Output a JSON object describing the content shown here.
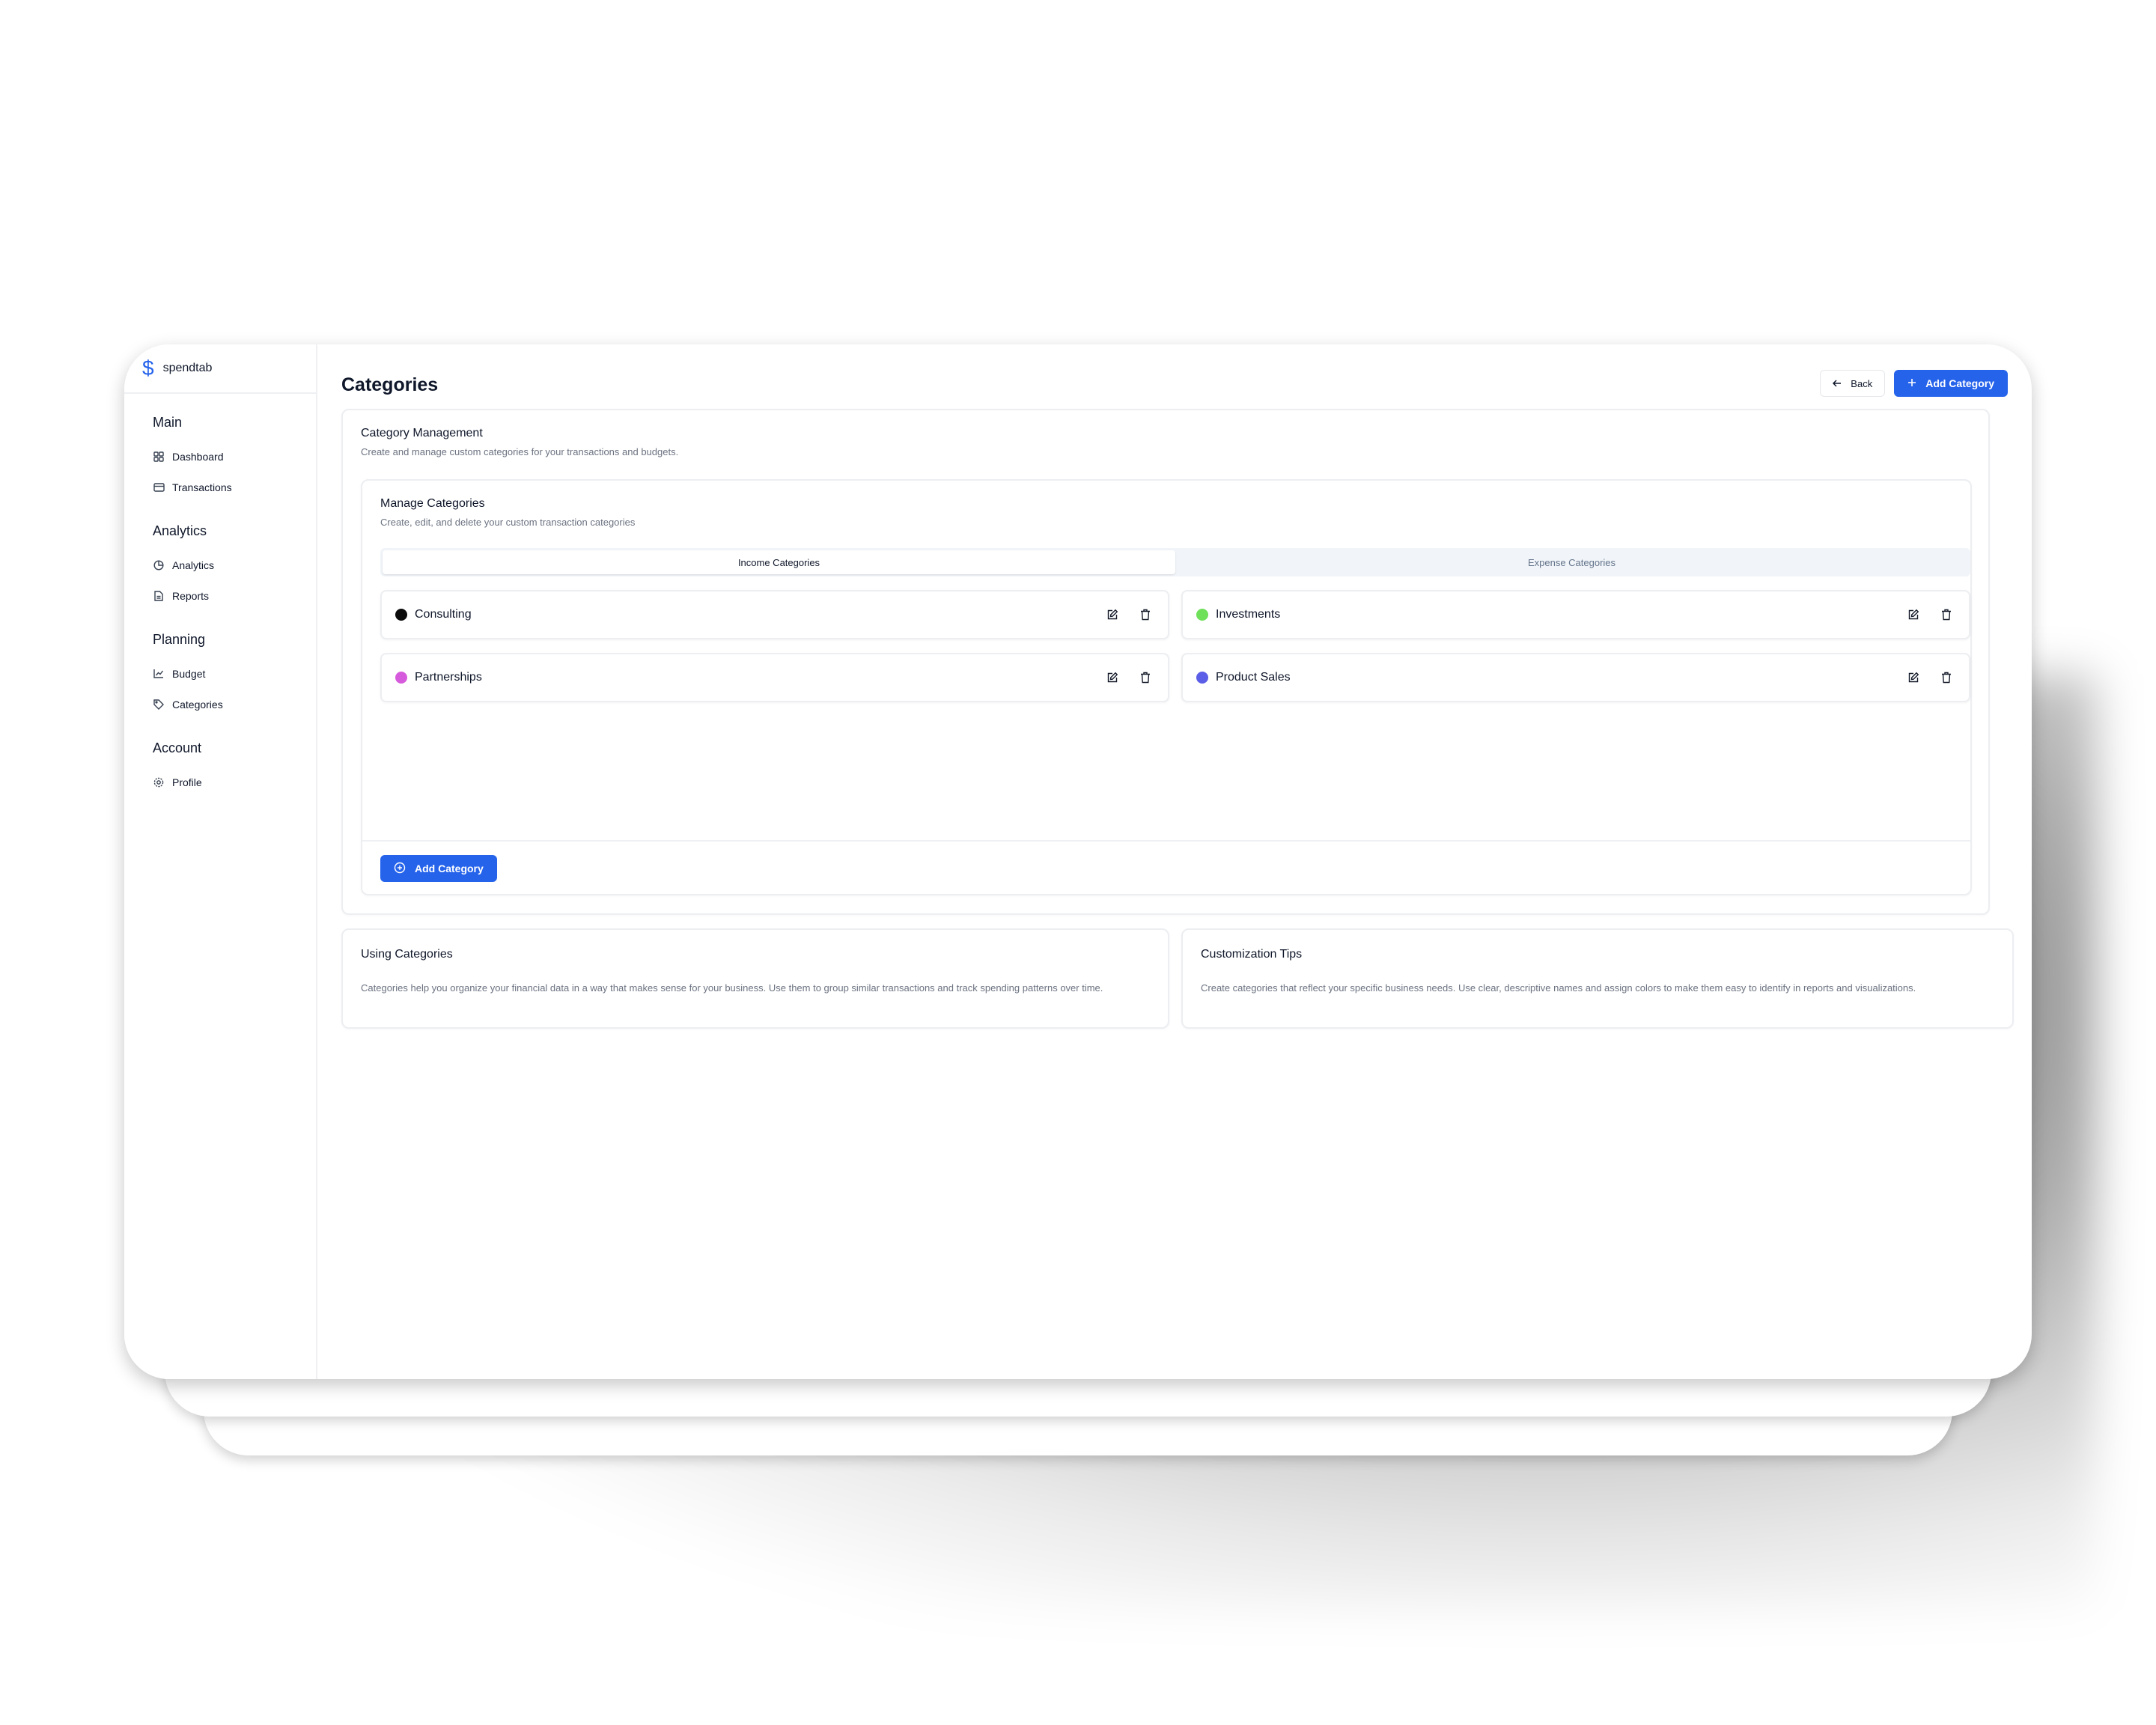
{
  "app": {
    "name": "spendtab"
  },
  "sidebar": {
    "sections": [
      {
        "title": "Main",
        "items": [
          {
            "label": "Dashboard",
            "icon": "grid-icon"
          },
          {
            "label": "Transactions",
            "icon": "credit-card-icon"
          }
        ]
      },
      {
        "title": "Analytics",
        "items": [
          {
            "label": "Analytics",
            "icon": "pie-chart-icon"
          },
          {
            "label": "Reports",
            "icon": "file-text-icon"
          }
        ]
      },
      {
        "title": "Planning",
        "items": [
          {
            "label": "Budget",
            "icon": "line-chart-icon"
          },
          {
            "label": "Categories",
            "icon": "tag-icon"
          }
        ]
      },
      {
        "title": "Account",
        "items": [
          {
            "label": "Profile",
            "icon": "settings-icon"
          }
        ]
      }
    ]
  },
  "header": {
    "title": "Categories",
    "back_label": "Back",
    "add_label": "Add Category"
  },
  "management": {
    "title": "Category Management",
    "subtitle": "Create and manage custom categories for your transactions and budgets."
  },
  "manage": {
    "title": "Manage Categories",
    "subtitle": "Create, edit, and delete your custom transaction categories",
    "tabs": [
      {
        "label": "Income Categories",
        "active": true
      },
      {
        "label": "Expense Categories",
        "active": false
      }
    ],
    "categories": [
      {
        "label": "Consulting",
        "color": "#0b0b0b"
      },
      {
        "label": "Investments",
        "color": "#6ee05a"
      },
      {
        "label": "Partnerships",
        "color": "#d65bdc"
      },
      {
        "label": "Product Sales",
        "color": "#5b5ee6"
      }
    ],
    "add_label": "Add Category"
  },
  "tips": [
    {
      "title": "Using Categories",
      "body": "Categories help you organize your financial data in a way that makes sense for your business. Use them to group similar transactions and track spending patterns over time."
    },
    {
      "title": "Customization Tips",
      "body": "Create categories that reflect your specific business needs. Use clear, descriptive names and assign colors to make them easy to identify in reports and visualizations."
    }
  ],
  "colors": {
    "accent": "#2563eb"
  }
}
